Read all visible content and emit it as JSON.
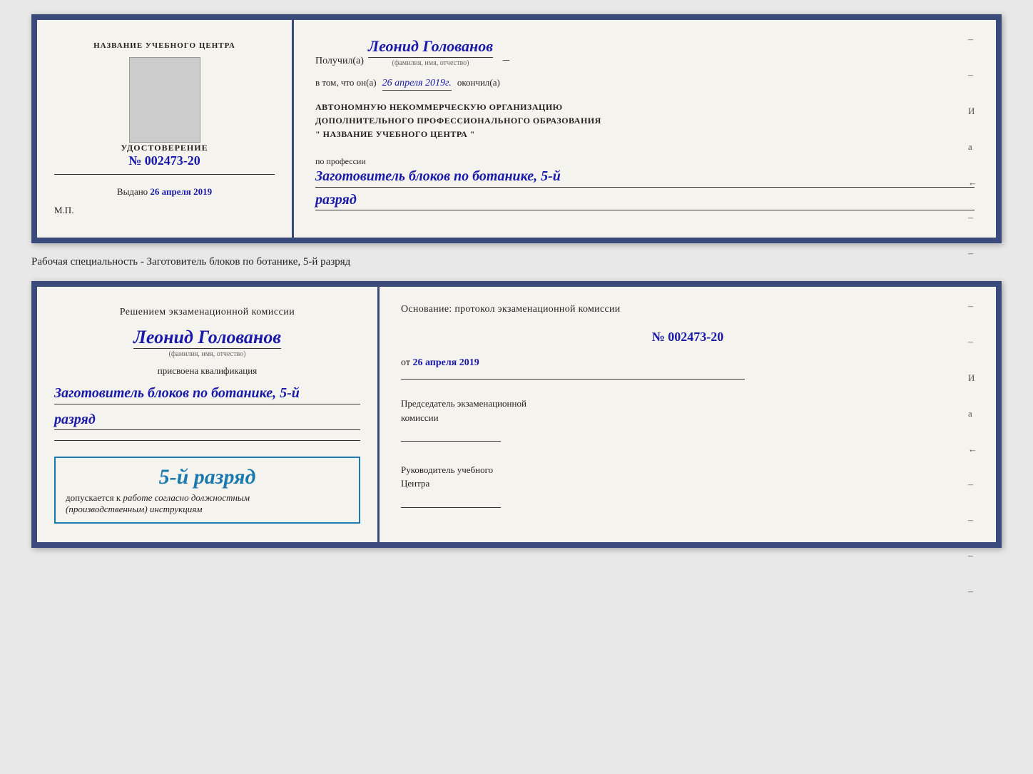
{
  "top_card": {
    "left": {
      "title": "НАЗВАНИЕ УЧЕБНОГО ЦЕНТРА",
      "cert_label": "УДОСТОВЕРЕНИЕ",
      "cert_no_prefix": "№",
      "cert_no": "002473-20",
      "issued_label": "Выдано",
      "issued_date": "26 апреля 2019",
      "mp_label": "М.П."
    },
    "right": {
      "received_label": "Получил(а)",
      "recipient_name": "Леонид Голованов",
      "fio_label": "(фамилия, имя, отчество)",
      "confirm_text": "в том, что он(а)",
      "confirm_date": "26 апреля 2019г.",
      "finished_label": "окончил(а)",
      "org_line1": "АВТОНОМНУЮ НЕКОММЕРЧЕСКУЮ ОРГАНИЗАЦИЮ",
      "org_line2": "ДОПОЛНИТЕЛЬНОГО ПРОФЕССИОНАЛЬНОГО ОБРАЗОВАНИЯ",
      "org_line3": "\"   НАЗВАНИЕ УЧЕБНОГО ЦЕНТРА   \"",
      "profession_label": "по профессии",
      "profession_value": "Заготовитель блоков по ботанике, 5-й",
      "rank_value": "разряд",
      "right_markers": [
        "–",
        "–",
        "И",
        "а",
        "←",
        "–",
        "–",
        "–",
        "–"
      ]
    }
  },
  "subtitle": "Рабочая специальность - Заготовитель блоков по ботанике, 5-й разряд",
  "bottom_card": {
    "left": {
      "decision_text": "Решением экзаменационной комиссии",
      "person_name": "Леонид Голованов",
      "fio_label": "(фамилия, имя, отчество)",
      "qualification_label": "присвоена квалификация",
      "qualification_value": "Заготовитель блоков по ботанике, 5-й",
      "rank_value": "разряд",
      "badge_rank": "5-й разряд",
      "allowed_text_pre": "допускается к",
      "allowed_text_italic": "работе согласно должностным",
      "allowed_text_italic2": "(производственным) инструкциям"
    },
    "right": {
      "basis_text": "Основание: протокол экзаменационной комиссии",
      "protocol_no_prefix": "№",
      "protocol_no": "002473-20",
      "date_prefix": "от",
      "protocol_date": "26 апреля 2019",
      "chairman_title": "Председатель экзаменационной",
      "chairman_subtitle": "комиссии",
      "leader_title": "Руководитель учебного",
      "leader_subtitle": "Центра",
      "right_markers": [
        "–",
        "–",
        "И",
        "а",
        "←",
        "–",
        "–",
        "–",
        "–"
      ]
    }
  }
}
